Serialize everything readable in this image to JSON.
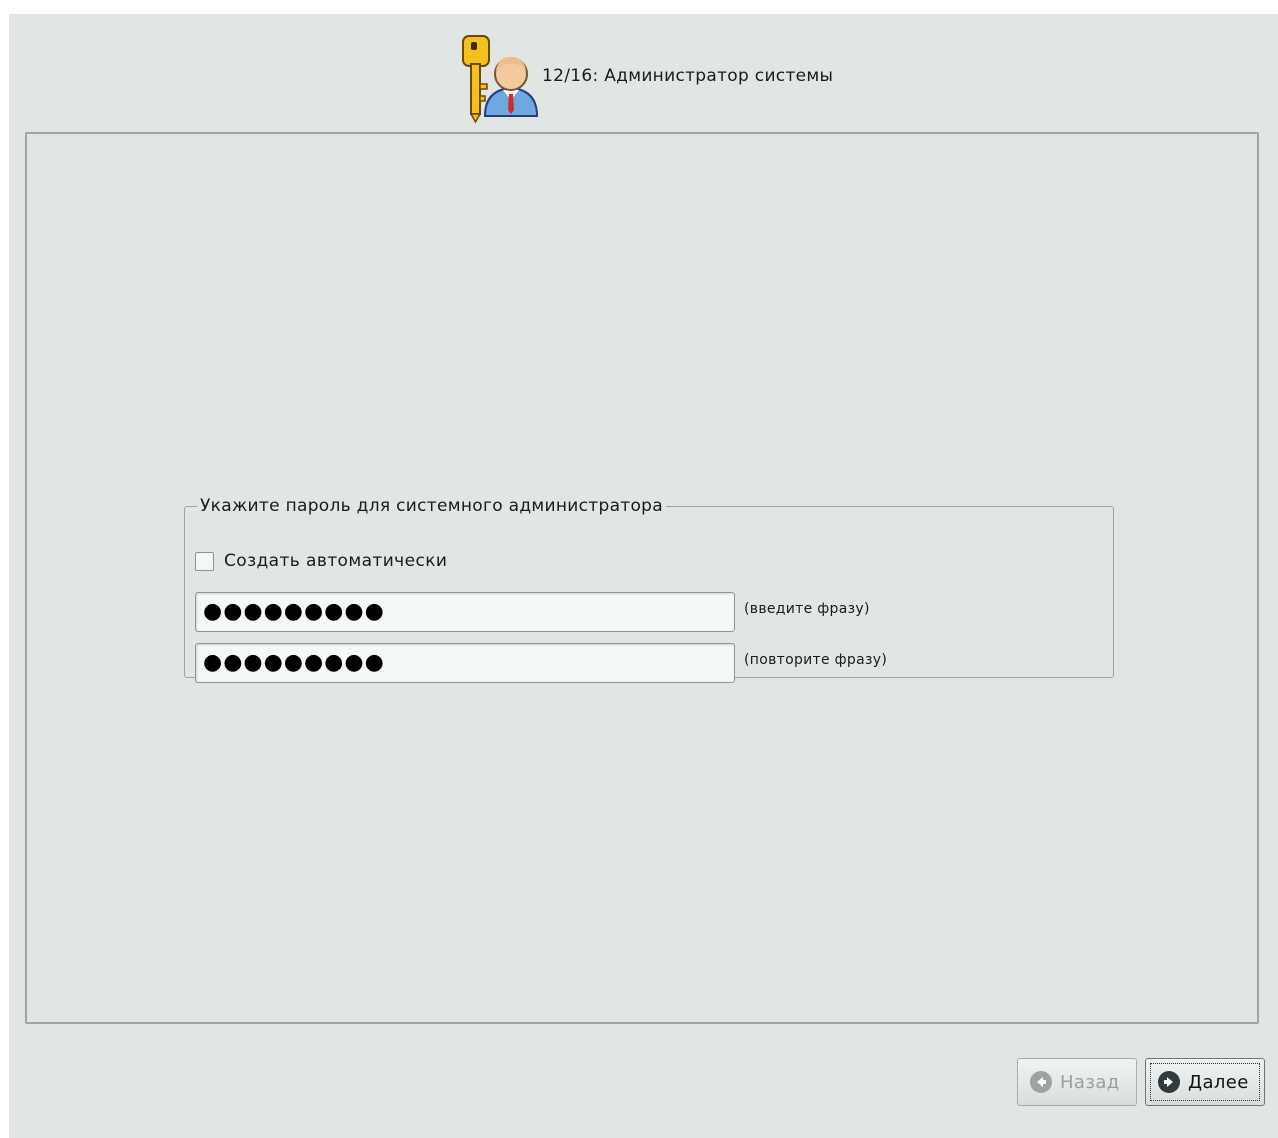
{
  "window": {
    "step_title": "12/16: Администратор системы",
    "header_icon": "key-user-icon"
  },
  "password_group": {
    "legend": "Укажите пароль для системного администратора",
    "auto_generate_label": "Создать автоматически",
    "auto_generate_checked": false,
    "password_value": "●●●●●●●●●",
    "password_hint": "(введите фразу)",
    "confirm_value": "●●●●●●●●●",
    "confirm_hint": "(повторите фразу)"
  },
  "buttons": {
    "back_label": "Назад",
    "back_icon": "arrow-left-icon",
    "back_enabled": false,
    "next_label": "Далее",
    "next_icon": "arrow-right-icon"
  },
  "colors": {
    "background": "#e1e6e5",
    "input_background": "#f4f9f5",
    "key_yellow": "#f3c21e",
    "tie_red": "#d7282e"
  }
}
